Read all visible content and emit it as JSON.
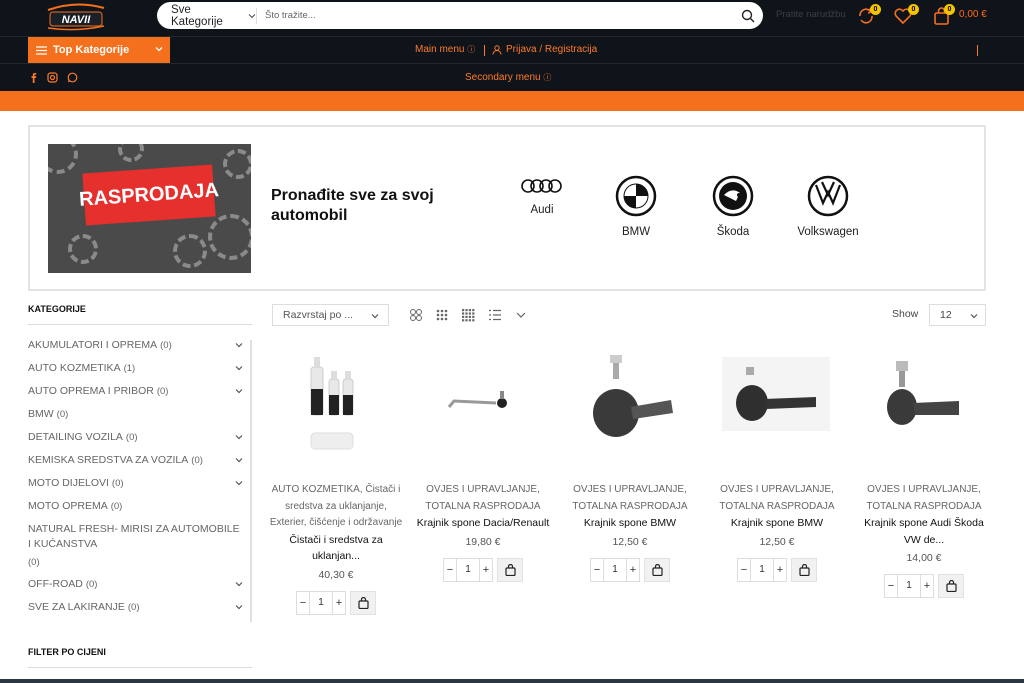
{
  "header": {
    "logo_text": "NAVII",
    "search_category": "Sve Kategorije",
    "search_placeholder": "Što tražite...",
    "track_order": "Pratite narudžbu",
    "compare_count": "0",
    "wishlist_count": "0",
    "cart_count": "0",
    "cart_total": "0,00 €"
  },
  "nav": {
    "top_categories": "Top Kategorije",
    "main_menu": "Main menu",
    "login": "Prijava / Registracija",
    "secondary_menu": "Secondary menu"
  },
  "banner": {
    "promo_text": "RASPRODAJA",
    "tagline": "Pronađite sve za svoj automobil",
    "brands": [
      "Audi",
      "BMW",
      "Škoda",
      "Volkswagen"
    ]
  },
  "sidebar": {
    "categories_heading": "KATEGORIJE",
    "categories": [
      {
        "label": "AKUMULATORI I OPREMA",
        "count": "(0)"
      },
      {
        "label": "AUTO KOZMETIKA",
        "count": "(1)"
      },
      {
        "label": "AUTO OPREMA I PRIBOR",
        "count": "(0)"
      },
      {
        "label": "BMW",
        "count": "(0)"
      },
      {
        "label": "DETAILING VOZILA",
        "count": "(0)"
      },
      {
        "label": "KEMISKA SREDSTVA ZA VOZILA",
        "count": "(0)"
      },
      {
        "label": "MOTO DIJELOVI",
        "count": "(0)"
      },
      {
        "label": "MOTO OPREMA",
        "count": "(0)"
      },
      {
        "label": "NATURAL FRESH- MIRISI ZA AUTOMOBILE I KUĆANSTVA",
        "count": "(0)"
      },
      {
        "label": "OFF-ROAD",
        "count": "(0)"
      },
      {
        "label": "SVE ZA LAKIRANJE",
        "count": "(0)"
      }
    ],
    "filter_heading": "FILTER PO CIJENI"
  },
  "toolbar": {
    "sort_label": "Razvrstaj po ...",
    "show_label": "Show",
    "per_page": "12"
  },
  "products": [
    {
      "cats": "AUTO KOZMETIKA, Čistači i sredstva za uklanjanje, Exterier, čišćenje i održavanje",
      "title": "Čistači i sredstva za uklanjan...",
      "price": "40,30 €",
      "qty": "1"
    },
    {
      "cats": "OVJES I UPRAVLJANJE, TOTALNA RASPRODAJA",
      "title": "Krajnik spone Dacia/Renault",
      "price": "19,80 €",
      "qty": "1"
    },
    {
      "cats": "OVJES I UPRAVLJANJE, TOTALNA RASPRODAJA",
      "title": "Krajnik spone BMW",
      "price": "12,50 €",
      "qty": "1"
    },
    {
      "cats": "OVJES I UPRAVLJANJE, TOTALNA RASPRODAJA",
      "title": "Krajnik spone BMW",
      "price": "12,50 €",
      "qty": "1"
    },
    {
      "cats": "OVJES I UPRAVLJANJE, TOTALNA RASPRODAJA",
      "title": "Krajnik spone Audi Škoda VW de...",
      "price": "14,00 €",
      "qty": "1"
    }
  ],
  "colors": {
    "accent": "#f5701d",
    "dark": "#0f141a",
    "badge": "#f5c400"
  }
}
